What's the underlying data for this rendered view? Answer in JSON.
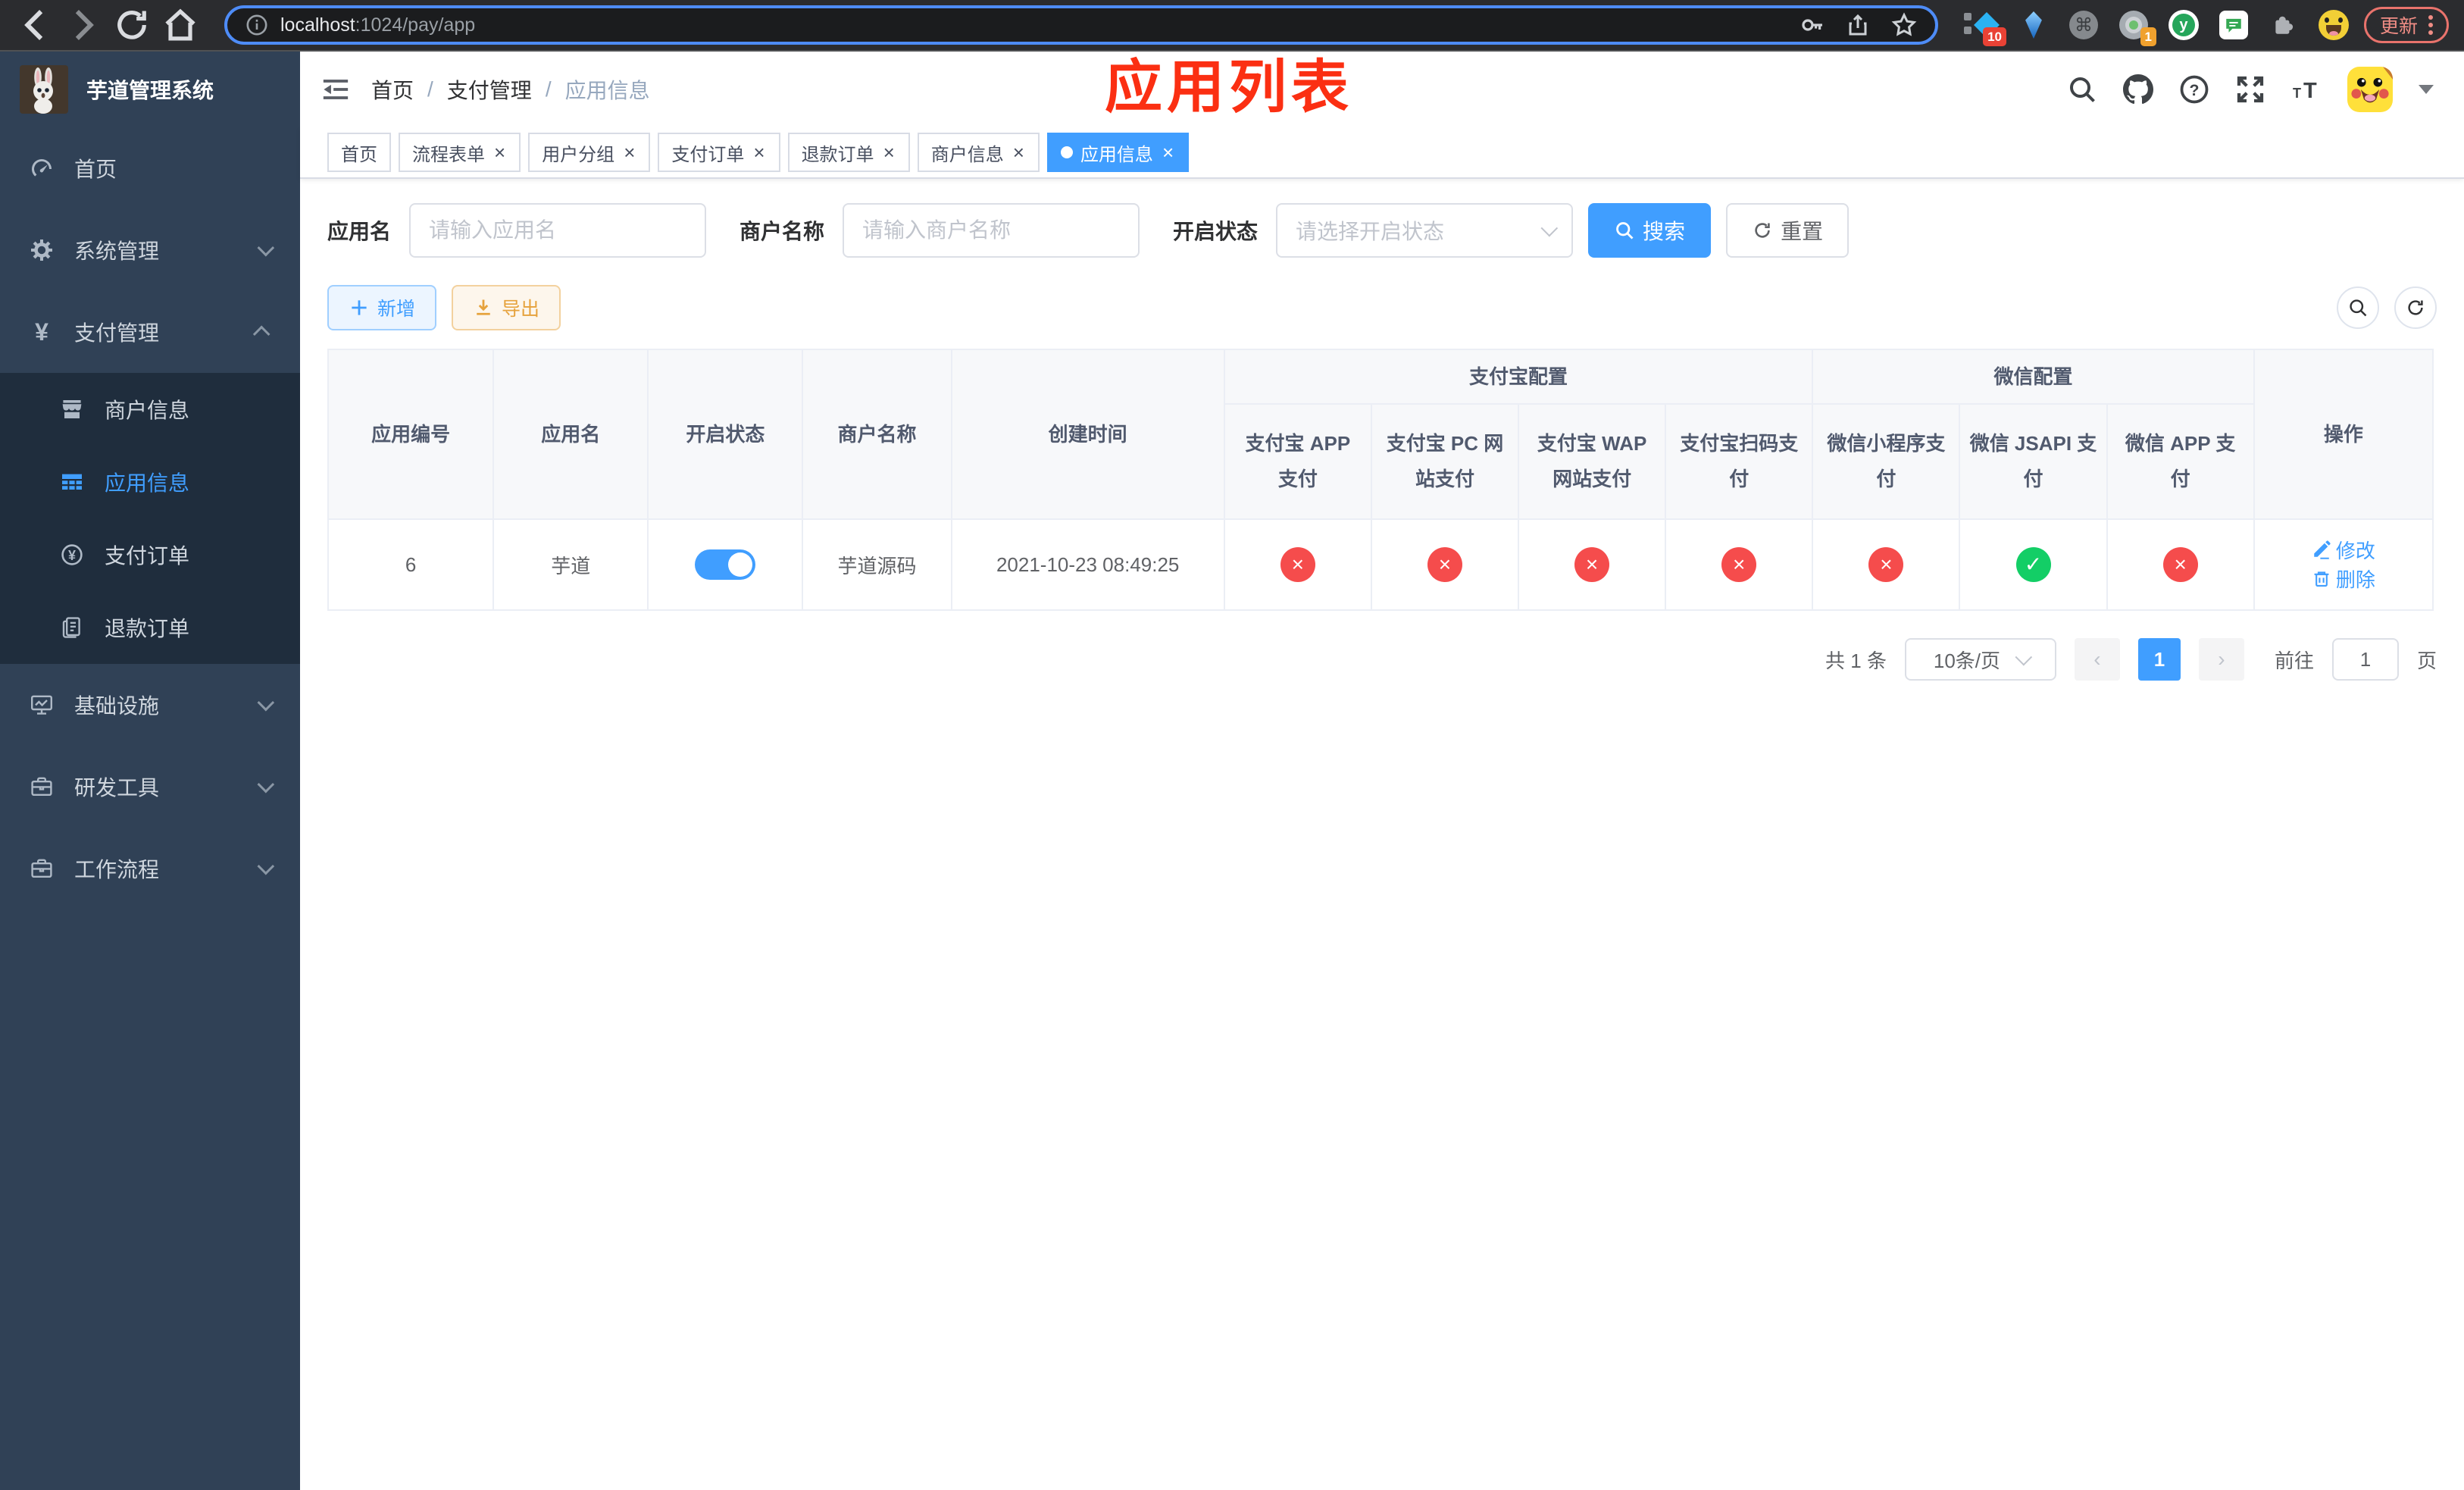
{
  "colors": {
    "primary": "#409eff",
    "success": "#13ce66",
    "danger": "#f54c4c",
    "warning": "#e6a23c",
    "annotation": "#fb2f12"
  },
  "browser": {
    "url_host": "localhost",
    "url_rest": ":1024/pay/app",
    "update_label": "更新",
    "ext_badge_a": "10",
    "ext_badge_b": "1",
    "y_ext_letter": "y",
    "cmd_glyph": "⌘"
  },
  "sidebar": {
    "logo_title": "芋道管理系统",
    "menu": [
      {
        "label": "首页",
        "icon": "dashboard-icon"
      },
      {
        "label": "系统管理",
        "icon": "gear-icon",
        "arrow": "down"
      },
      {
        "label": "支付管理",
        "icon": "yuan-icon",
        "arrow": "up",
        "children": [
          {
            "label": "商户信息",
            "icon": "shop-icon"
          },
          {
            "label": "应用信息",
            "icon": "grid-icon",
            "active": true
          },
          {
            "label": "支付订单",
            "icon": "pay-order-icon"
          },
          {
            "label": "退款订单",
            "icon": "refund-order-icon"
          }
        ]
      },
      {
        "label": "基础设施",
        "icon": "infrastructure-icon",
        "arrow": "down"
      },
      {
        "label": "研发工具",
        "icon": "devtools-icon",
        "arrow": "down"
      },
      {
        "label": "工作流程",
        "icon": "workflow-icon",
        "arrow": "down"
      }
    ]
  },
  "header": {
    "breadcrumb": [
      "首页",
      "支付管理",
      "应用信息"
    ]
  },
  "annotation": {
    "text": "应用列表"
  },
  "tags": [
    {
      "label": "首页",
      "closable": false,
      "active": false
    },
    {
      "label": "流程表单",
      "closable": true,
      "active": false
    },
    {
      "label": "用户分组",
      "closable": true,
      "active": false
    },
    {
      "label": "支付订单",
      "closable": true,
      "active": false
    },
    {
      "label": "退款订单",
      "closable": true,
      "active": false
    },
    {
      "label": "商户信息",
      "closable": true,
      "active": false
    },
    {
      "label": "应用信息",
      "closable": true,
      "active": true
    }
  ],
  "filters": {
    "fields": [
      {
        "label": "应用名",
        "placeholder": "请输入应用名",
        "type": "input"
      },
      {
        "label": "商户名称",
        "placeholder": "请输入商户名称",
        "type": "input"
      },
      {
        "label": "开启状态",
        "placeholder": "请选择开启状态",
        "type": "select"
      }
    ],
    "search_label": "搜索",
    "reset_label": "重置"
  },
  "toolbar": {
    "add_label": "新增",
    "export_label": "导出"
  },
  "table": {
    "columns_simple": [
      "应用编号",
      "应用名",
      "开启状态",
      "商户名称",
      "创建时间"
    ],
    "group_alipay": "支付宝配置",
    "group_wechat": "微信配置",
    "col_action": "操作",
    "alipay_cols": [
      "支付宝 APP 支付",
      "支付宝 PC 网站支付",
      "支付宝 WAP 网站支付",
      "支付宝扫码支付"
    ],
    "wechat_cols": [
      "微信小程序支付",
      "微信 JSAPI 支付",
      "微信 APP 支付"
    ],
    "row": {
      "id": "6",
      "name": "芋道",
      "enabled": true,
      "merchant": "芋道源码",
      "created": "2021-10-23 08:49:25",
      "channels": [
        "cross",
        "cross",
        "cross",
        "cross",
        "cross",
        "check",
        "cross"
      ],
      "edit_label": "修改",
      "delete_label": "删除"
    }
  },
  "pagination": {
    "total": "共 1 条",
    "per_page": "10条/页",
    "page": "1",
    "goto_prefix": "前往",
    "goto_value": "1",
    "goto_suffix": "页"
  }
}
